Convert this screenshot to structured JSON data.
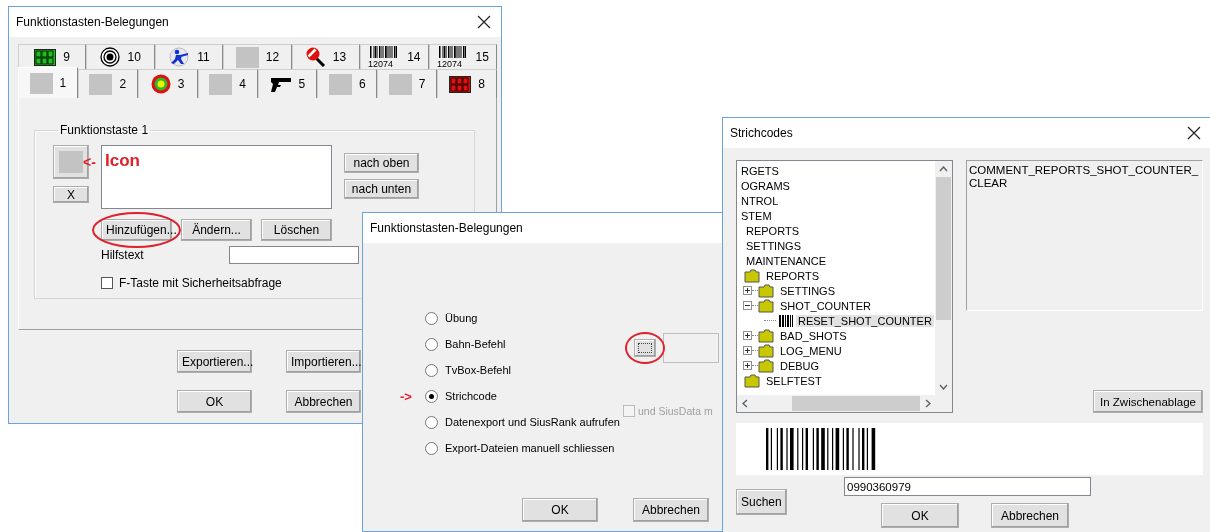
{
  "tab_dialog": {
    "title": "Funktionstasten-Belegungen",
    "tabs_back": [
      {
        "label": "9",
        "selected": false
      },
      {
        "label": "10",
        "selected": false
      },
      {
        "label": "11",
        "selected": false
      },
      {
        "label": "12",
        "selected": false
      },
      {
        "label": "13",
        "selected": false
      },
      {
        "label": "14",
        "selected": false,
        "icon_caption": "12074"
      },
      {
        "label": "15",
        "selected": false,
        "icon_caption": "12074"
      }
    ],
    "tabs_front": [
      {
        "label": "1",
        "selected": true
      },
      {
        "label": "2",
        "selected": false
      },
      {
        "label": "3",
        "selected": false
      },
      {
        "label": "4",
        "selected": false
      },
      {
        "label": "5",
        "selected": false
      },
      {
        "label": "6",
        "selected": false
      },
      {
        "label": "7",
        "selected": false
      },
      {
        "label": "8",
        "selected": false
      }
    ],
    "group": {
      "title": "Funktionstaste 1",
      "clear_button": "X",
      "annotation": {
        "arrow": "<-",
        "text": "Icon"
      },
      "move_buttons": [
        "nach oben",
        "nach unten"
      ],
      "actions": [
        {
          "label": "Hinzufügen...",
          "circled": true
        },
        {
          "label": "Ändern...",
          "circled": false
        },
        {
          "label": "Löschen",
          "circled": false
        }
      ],
      "help_label": "Hilfstext",
      "confirm_checkbox": {
        "label": "F-Taste mit Sicherheitsabfrage",
        "checked": false
      }
    },
    "buttons": [
      "Exportieren...",
      "Importieren...",
      "OK",
      "Abbrechen"
    ]
  },
  "action_dialog": {
    "title": "Funktionstasten-Belegungen",
    "options": [
      {
        "label": "Übung",
        "selected": false
      },
      {
        "label": "Bahn-Befehl",
        "selected": false
      },
      {
        "label": "TvBox-Befehl",
        "selected": false
      },
      {
        "label": "Strichcode",
        "selected": true,
        "annotation": "->"
      },
      {
        "label": "Datenexport und SiusRank aufrufen",
        "selected": false
      },
      {
        "label": "Export-Dateien manuell schliessen",
        "selected": false
      }
    ],
    "picker": {
      "circled": true
    },
    "siusdata_checkbox": {
      "label": "und SiusData m",
      "checked": false,
      "disabled": true
    },
    "buttons": [
      "OK",
      "Abbrechen"
    ]
  },
  "barcode_dialog": {
    "title": "Strichcodes",
    "tree": [
      {
        "label": "RGETS",
        "kind": "plain",
        "selected": false
      },
      {
        "label": "OGRAMS",
        "kind": "plain",
        "selected": false
      },
      {
        "label": "NTROL",
        "kind": "plain",
        "selected": false
      },
      {
        "label": "STEM",
        "kind": "plain",
        "selected": false,
        "children": [
          {
            "label": "REPORTS",
            "kind": "plain",
            "selected": false
          },
          {
            "label": "SETTINGS",
            "kind": "plain",
            "selected": false
          },
          {
            "label": "MAINTENANCE",
            "kind": "plain",
            "selected": false
          },
          {
            "label": "REPORTS",
            "kind": "folder",
            "selected": false,
            "children": [
              {
                "label": "SETTINGS",
                "kind": "folder",
                "selected": false,
                "expanded": false
              },
              {
                "label": "SHOT_COUNTER",
                "kind": "folder",
                "selected": false,
                "expanded": true,
                "children": [
                  {
                    "label": "RESET_SHOT_COUNTER",
                    "kind": "barcode",
                    "selected": true
                  }
                ]
              },
              {
                "label": "BAD_SHOTS",
                "kind": "folder",
                "selected": false,
                "expanded": false
              },
              {
                "label": "LOG_MENU",
                "kind": "folder",
                "selected": false,
                "expanded": false
              },
              {
                "label": "DEBUG",
                "kind": "folder",
                "selected": false,
                "expanded": false
              }
            ]
          },
          {
            "label": "SELFTEST",
            "kind": "folder",
            "selected": false
          }
        ]
      }
    ],
    "comment": "COMMENT_REPORTS_SHOT_COUNTER_CLEAR",
    "copy_button": "In Zwischenablage",
    "code": "0990360979",
    "search_button": "Suchen",
    "buttons": [
      "OK",
      "Abbrechen"
    ]
  }
}
